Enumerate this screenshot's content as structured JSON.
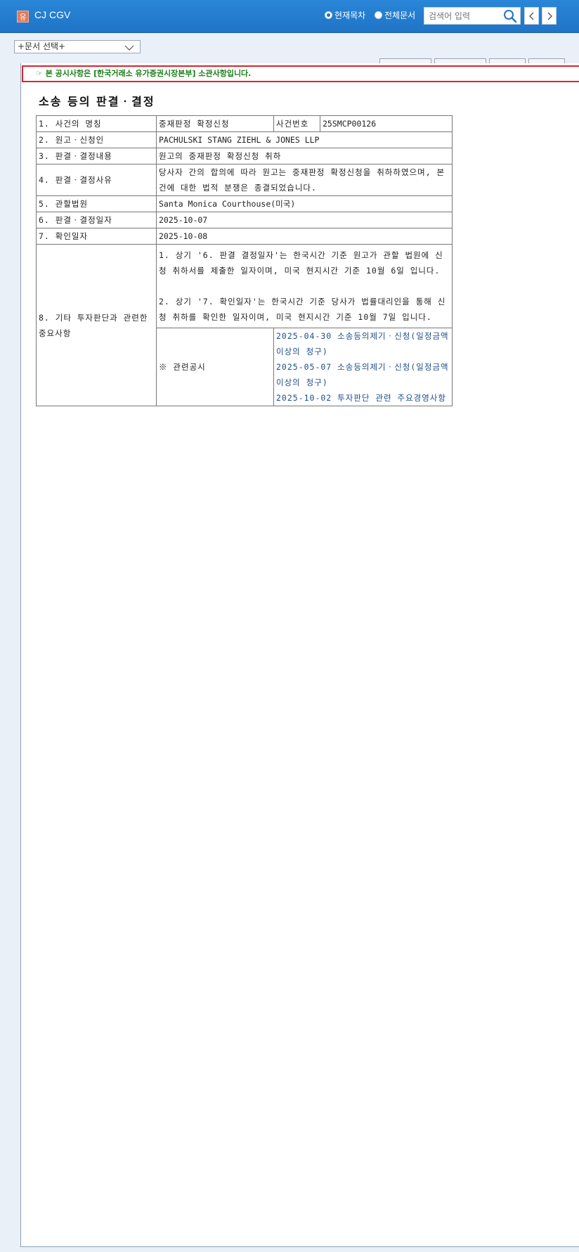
{
  "header": {
    "logo_char": "유",
    "app_title": "CJ CGV",
    "radio_current": "현재목차",
    "radio_all": "전체문서",
    "search_placeholder": "검색어 입력"
  },
  "doc_select": {
    "label": "+문서 선택+"
  },
  "notice": {
    "text": "☞ 본 공시사항은 [한국거래소 유가증권시장본부] 소관사항입니다."
  },
  "document": {
    "title": "소송 등의 판결ㆍ결정",
    "rows": {
      "case_name_label": "1. 사건의 명칭",
      "case_name_value": "중재판정 확정신청",
      "case_no_label": "사건번호",
      "case_no_value": "25SMCP00126",
      "plaintiff_label": "2. 원고ㆍ신청인",
      "plaintiff_value": "PACHULSKI STANG ZIEHL & JONES LLP",
      "content_label": "3. 판결ㆍ결정내용",
      "content_value": "원고의 중재판정 확정신청 취하",
      "reason_label": "4. 판결ㆍ결정사유",
      "reason_value": "당사자 간의 합의에 따라 원고는 중재판정 확정신청을 취하하였으며, 본 건에 대한 법적 분쟁은 종결되었습니다.",
      "court_label": "5. 관할법원",
      "court_value": "Santa Monica Courthouse(미국)",
      "decision_date_label": "6. 판결ㆍ결정일자",
      "decision_date_value": "2025-10-07",
      "confirm_date_label": "7. 확인일자",
      "confirm_date_value": "2025-10-08",
      "other_label": "8. 기타 투자판단과 관련한 중요사항",
      "other_note_1": "1. 상기 '6. 판결 결정일자'는 한국시간 기준 원고가 관할 법원에 신청 취하서를 제출한 일자이며, 미국 현지시간 기준 10월 6일 입니다.",
      "other_note_2": "2. 상기 '7. 확인일자'는 한국시간 기준 당사가 법률대리인을 통해 신청 취하를 확인한 일자이며, 미국 현지시간 기준 10월 7일 입니다.",
      "related_label": "※ 관련공시",
      "related_links": [
        "2025-04-30 소송등의제기ㆍ신청(일정금액 이상의 청구)",
        "2025-05-07 소송등의제기ㆍ신청(일정금액 이상의 청구)",
        "2025-10-02 투자판단 관련 주요경영사항"
      ]
    }
  },
  "colors": {
    "header_blue": "#1f74c6",
    "notice_red": "#d9232d",
    "notice_green": "#1a7f1a",
    "link_blue": "#1e4d8a"
  }
}
